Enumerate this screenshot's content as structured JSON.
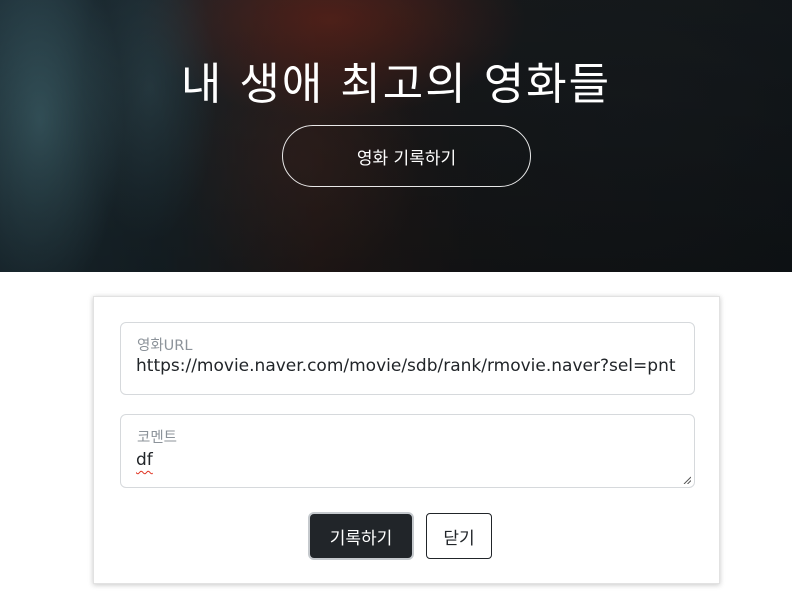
{
  "header": {
    "title": "내 생애 최고의 영화들",
    "open_form_button": "영화 기록하기"
  },
  "form": {
    "url_label": "영화URL",
    "url_value": "https://movie.naver.com/movie/sdb/rank/rmovie.naver?sel=pnt",
    "comment_label": "코멘트",
    "comment_value": "df",
    "save_button": "기록하기",
    "close_button": "닫기"
  },
  "colors": {
    "primary_button": "#212529",
    "field_border": "#d6d9dc",
    "label_text": "#8c939a"
  },
  "icons": {
    "textarea_resize": "resize-grip-icon"
  }
}
